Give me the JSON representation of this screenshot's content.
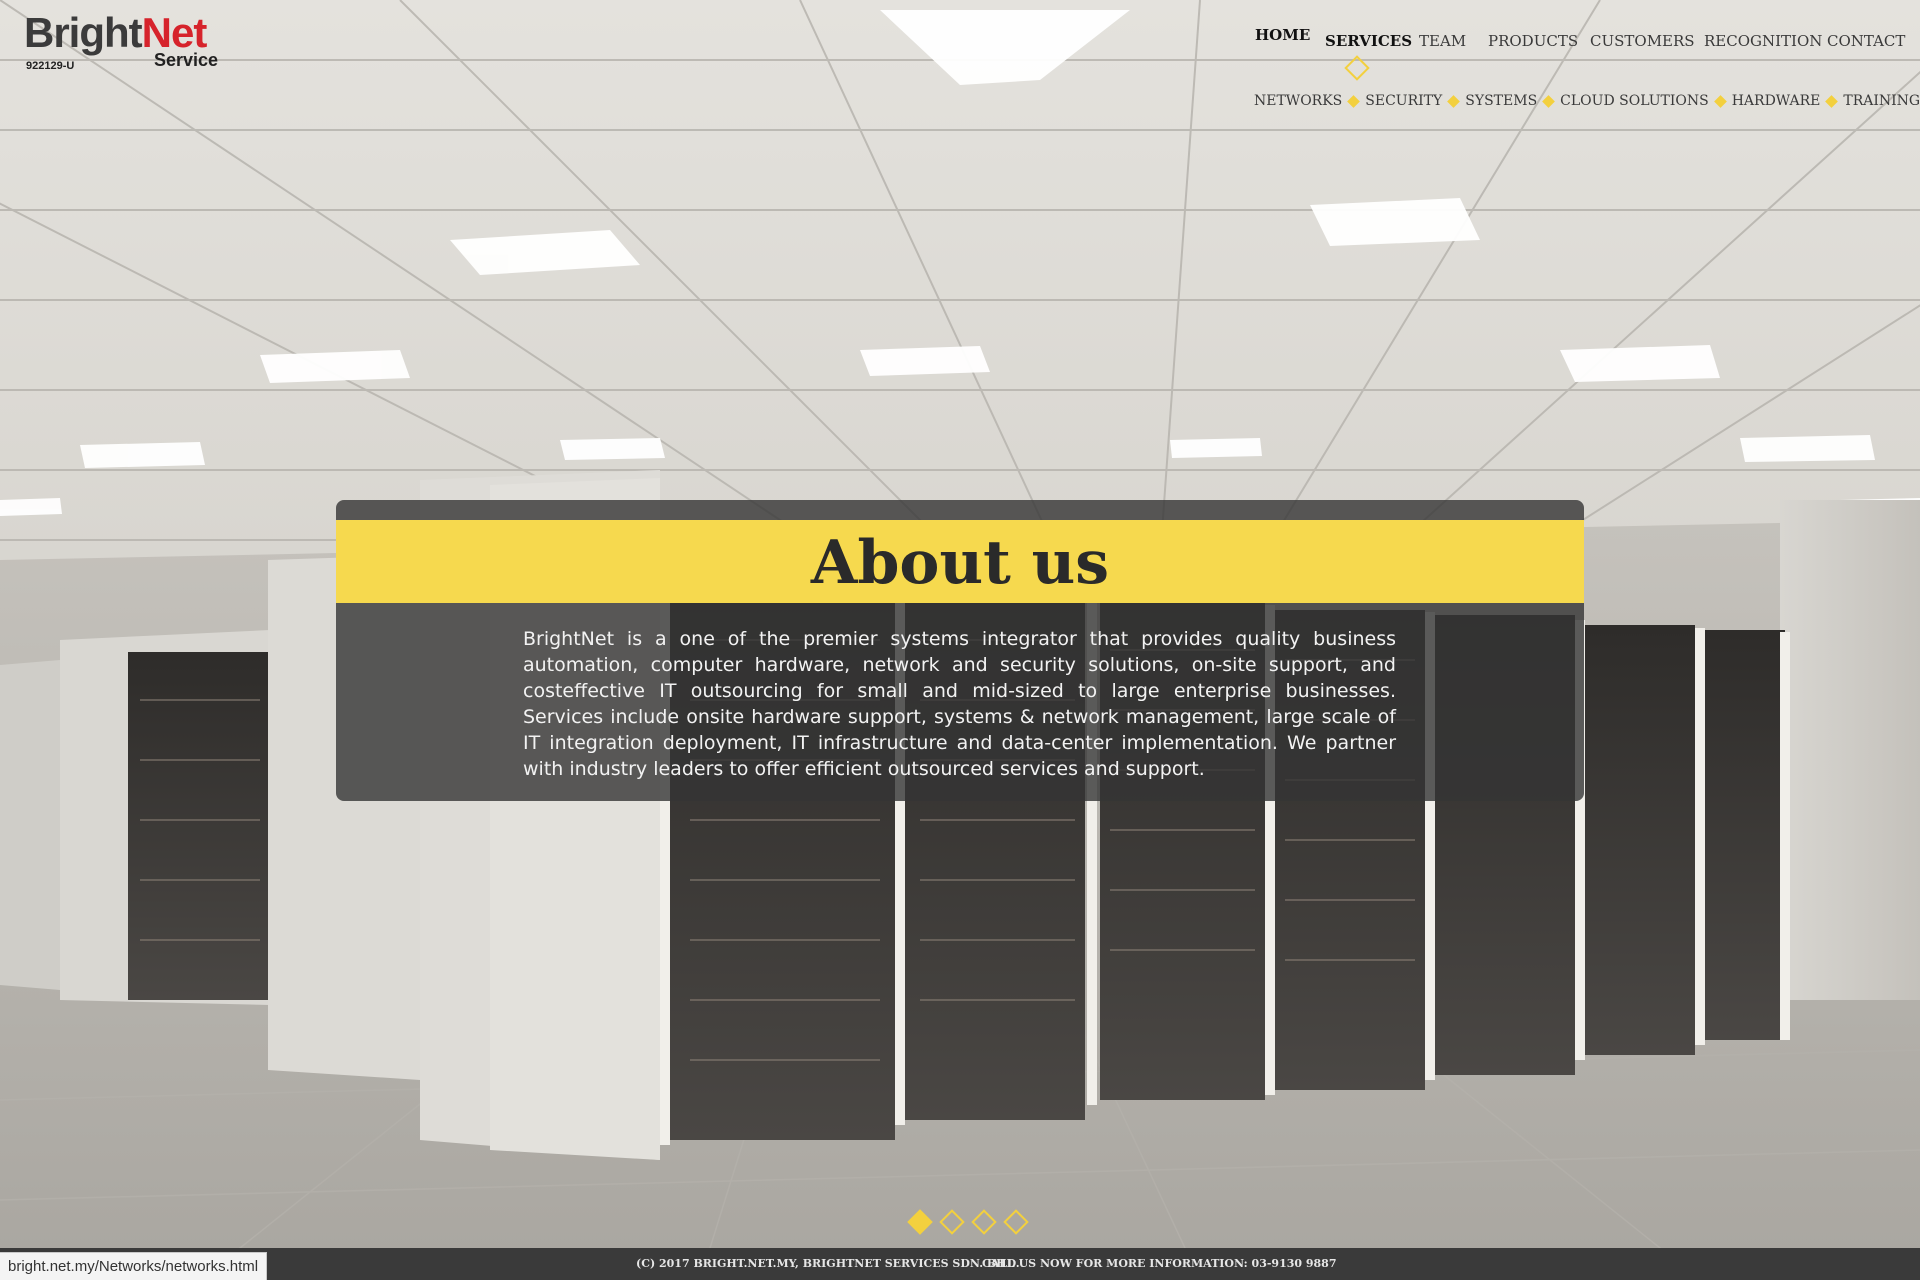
{
  "logo": {
    "brand_part1": "Bright",
    "brand_part2": "Net",
    "subtitle": "Service",
    "registration": "922129-U"
  },
  "nav": {
    "home": "HOME",
    "services": "SERVICES",
    "team": "TEAM",
    "products": "PRODUCTS",
    "customers": "CUSTOMERS",
    "recognition": "RECOGNITION",
    "contact": "CONTACT",
    "active": "SERVICES"
  },
  "subnav": {
    "networks": "NETWORKS",
    "security": "SECURITY",
    "systems": "SYSTEMS",
    "cloud": "CLOUD SOLUTIONS",
    "hardware": "HARDWARE",
    "training": "TRAINING"
  },
  "about": {
    "title": "About us",
    "body": "BrightNet is a one of the premier systems integrator that provides quality business automation, computer hardware, network and security solutions, on-site support, and costeffective IT outsourcing for small and mid-sized to large enterprise businesses. Services include onsite hardware support, systems & network management, large scale of IT integration deployment, IT infrastructure and data-center implementation. We partner with industry leaders to offer efficient outsourced services and support."
  },
  "slider": {
    "slide_count": 4,
    "active_slide": 1
  },
  "footer": {
    "copyright": "(C) 2017 BRIGHT.NET.MY, BRIGHTNET SERVICES SDN. BHD.",
    "call": "CALL US NOW FOR MORE INFORMATION: 03-9130 9887"
  },
  "status_bar": {
    "url": "bright.net.my/Networks/networks.html"
  },
  "colors": {
    "accent_yellow": "#f6d94e",
    "brand_red": "#d6232b",
    "panel_dark": "#343434",
    "footer_bg": "#3a3a3a"
  }
}
